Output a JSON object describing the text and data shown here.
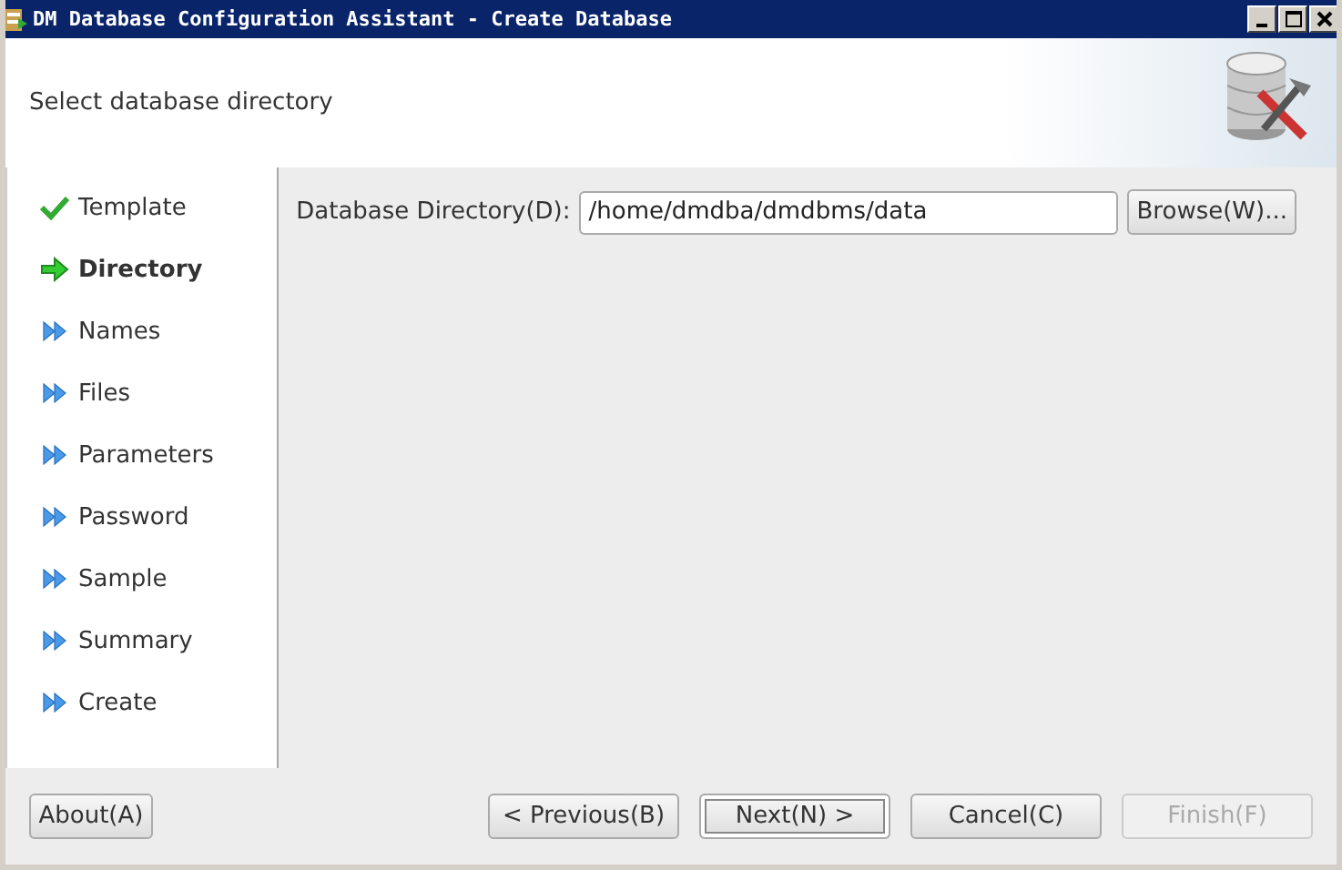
{
  "window": {
    "title": "DM Database Configuration Assistant - Create Database"
  },
  "header": {
    "title": "Select database directory"
  },
  "steps": [
    {
      "label": "Template",
      "kind": "done",
      "selected": false
    },
    {
      "label": "Directory",
      "kind": "current",
      "selected": true
    },
    {
      "label": "Names",
      "kind": "pending",
      "selected": false
    },
    {
      "label": "Files",
      "kind": "pending",
      "selected": false
    },
    {
      "label": "Parameters",
      "kind": "pending",
      "selected": false
    },
    {
      "label": "Password",
      "kind": "pending",
      "selected": false
    },
    {
      "label": "Sample",
      "kind": "pending",
      "selected": false
    },
    {
      "label": "Summary",
      "kind": "pending",
      "selected": false
    },
    {
      "label": "Create",
      "kind": "pending",
      "selected": false
    }
  ],
  "directory": {
    "label": "Database Directory(D):",
    "value": "/home/dmdba/dmdbms/data",
    "browse": "Browse(W)..."
  },
  "buttons": [
    {
      "label": "About(A)",
      "disabled": false,
      "default": false
    },
    {
      "label": "< Previous(B)",
      "disabled": false,
      "default": false
    },
    {
      "label": "Next(N) >",
      "disabled": false,
      "default": true
    },
    {
      "label": "Cancel(C)",
      "disabled": false,
      "default": false
    },
    {
      "label": "Finish(F)",
      "disabled": true,
      "default": false
    }
  ]
}
